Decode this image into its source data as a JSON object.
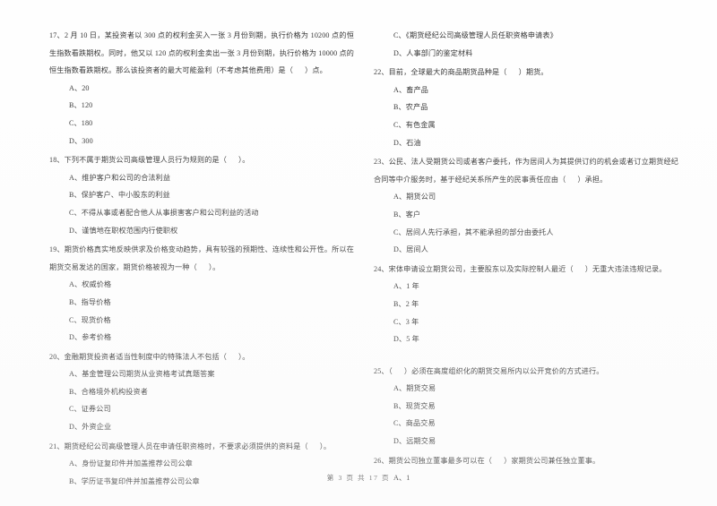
{
  "document": {
    "footer": "第 3 页 共 17 页",
    "page_number": "3",
    "total_pages": "17"
  },
  "left_column": {
    "questions": [
      {
        "stem": "17、2 月 10 日，某投资者以 300 点的权利金买入一张 3 月份到期，执行价格为 10200 点的恒生指数看跌期权。同时，他又以 120 点的权利金卖出一张 3 月份到期，执行价格为 10000 点的恒生指数看跌期权。那么该投资者的最大可能盈利（不考虑其他费用）是（      ）点。",
        "options": [
          "A、20",
          "B、120",
          "C、180",
          "D、300"
        ]
      },
      {
        "stem": "18、下列不属于期货公司高级管理人员行为规则的是（      ）。",
        "options": [
          "A、维护客户和公司的合法利益",
          "B、保护客户、中小股东的利益",
          "C、不得从事或者配合他人从事损害客户和公司利益的活动",
          "D、谨慎地在职权范围内行使职权"
        ]
      },
      {
        "stem": "19、期货价格真实地反映供求及价格变动趋势，具有较强的预期性、连续性和公开性。所以在期货交易发达的国家，期货价格被视为一种（      ）。",
        "options": [
          "A、权威价格",
          "B、指导价格",
          "C、现货价格",
          "D、参考价格"
        ]
      },
      {
        "stem": "20、金融期货投资者适当性制度中的特殊法人不包括（      ）。",
        "options": [
          "A、基金管理公司期货从业资格考试真题答案",
          "B、合格境外机构投资者",
          "C、证券公司",
          "D、外资企业"
        ]
      },
      {
        "stem": "21、期货经纪公司高级管理人员在申请任职资格时，不要求必须提供的资料是（      ）。",
        "options": [
          "A、身份证复印件并加盖推荐公司公章",
          "B、学历证书复印件并加盖推荐公司公章"
        ]
      }
    ]
  },
  "right_column": {
    "questions": [
      {
        "stem": "",
        "options": [
          "C、《期货经纪公司高级管理人员任职资格申请表》",
          "D、人事部门的鉴定材料"
        ]
      },
      {
        "stem": "22、目前，全球最大的商品期货品种是（      ）期货。",
        "options": [
          "A、畜产品",
          "B、农产品",
          "C、有色金属",
          "D、石油"
        ]
      },
      {
        "stem": "23、公民、法人受期货公司或者客户委托，作为居间人为其提供订约的机会或者订立期货经纪合同等中介服务时，基于经纪关系所产生的民事责任应由（      ）承担。",
        "options": [
          "A、期货公司",
          "B、客户",
          "C、居间人先行承担，其不能承担的部分由委托人",
          "D、居间人"
        ]
      },
      {
        "stem": "24、宋体申请设立期货公司，主要股东以及实际控制人最近（      ）无重大违法违规记录。",
        "options": [
          "A、1 年",
          "B、2 年",
          "C、3 年",
          "D、5 年"
        ]
      },
      {
        "stem": "25、（      ）必须在高度组织化的期货交易所内以公开竞价的方式进行。",
        "options": [
          "A、期货交易",
          "B、现货交易",
          "C、商品交易",
          "D、远期交易"
        ]
      },
      {
        "stem": "26、期货公司独立董事最多可以在（      ）家期货公司兼任独立董事。",
        "options": [
          "A、1"
        ]
      }
    ]
  }
}
